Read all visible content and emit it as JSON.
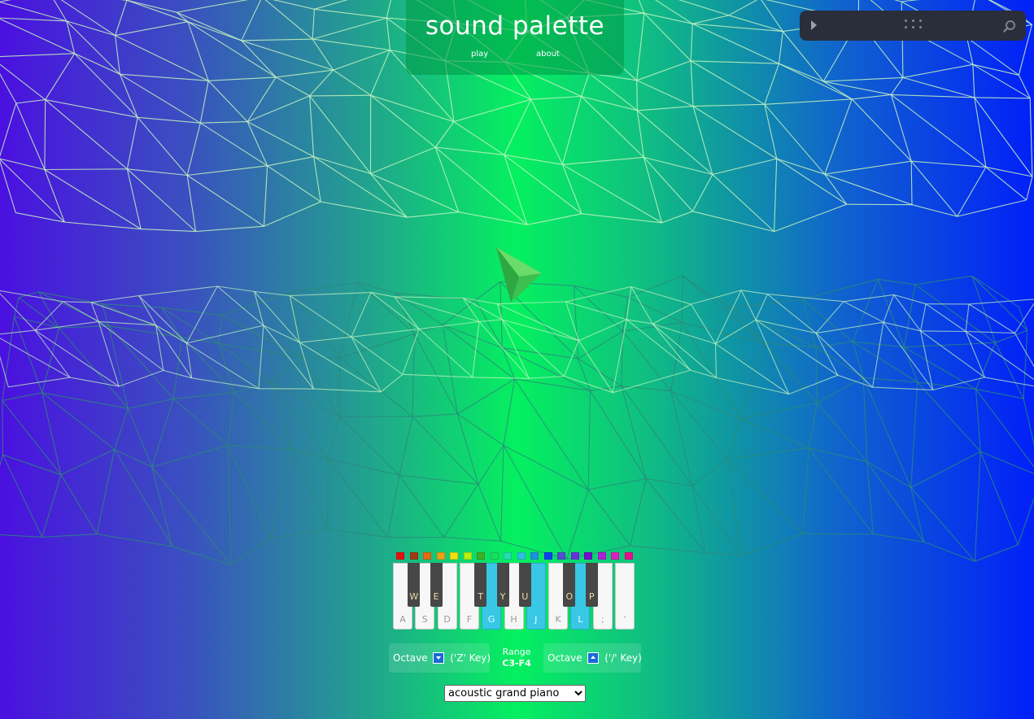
{
  "header": {
    "title": "sound palette",
    "nav": [
      {
        "label": "play"
      },
      {
        "label": "about"
      }
    ]
  },
  "mini_player": {
    "play_icon": "play-icon",
    "grip_icon": "drag-grip-icon",
    "search_icon": "magnifier-icon"
  },
  "play_button": {
    "icon": "play-triangle-icon"
  },
  "colors": {
    "background_gradient": [
      "#4a10e0",
      "#05f060",
      "#0220f8"
    ],
    "mesh_line": "#c8f5c0",
    "active_key": "#38c8e6",
    "swatches": [
      "#e81010",
      "#a03a10",
      "#e86a10",
      "#f0a010",
      "#f0e010",
      "#b8f010",
      "#40b020",
      "#18e060",
      "#20e0b0",
      "#30c0e0",
      "#2090e0",
      "#1040f0",
      "#5050d0",
      "#6a30e0",
      "#7010c8",
      "#b020d8",
      "#e020c0",
      "#e8108a"
    ]
  },
  "piano": {
    "white_keys": [
      {
        "label": "A",
        "active": false
      },
      {
        "label": "S",
        "active": false
      },
      {
        "label": "D",
        "active": false
      },
      {
        "label": "F",
        "active": false
      },
      {
        "label": "G",
        "active": true
      },
      {
        "label": "H",
        "active": false
      },
      {
        "label": "J",
        "active": true
      },
      {
        "label": "K",
        "active": false
      },
      {
        "label": "L",
        "active": true
      },
      {
        "label": ";",
        "active": false
      },
      {
        "label": "'",
        "active": false
      }
    ],
    "black_keys": [
      "W",
      "E",
      "T",
      "Y",
      "U",
      "O",
      "P"
    ]
  },
  "octave_down": {
    "label": "Octave",
    "shortcut": "('Z' Key)"
  },
  "octave_up": {
    "label": "Octave",
    "shortcut": "('/' Key)"
  },
  "range": {
    "label": "Range",
    "value": "C3-F4"
  },
  "instrument": {
    "selected": "acoustic grand piano",
    "options": [
      "acoustic grand piano"
    ]
  }
}
